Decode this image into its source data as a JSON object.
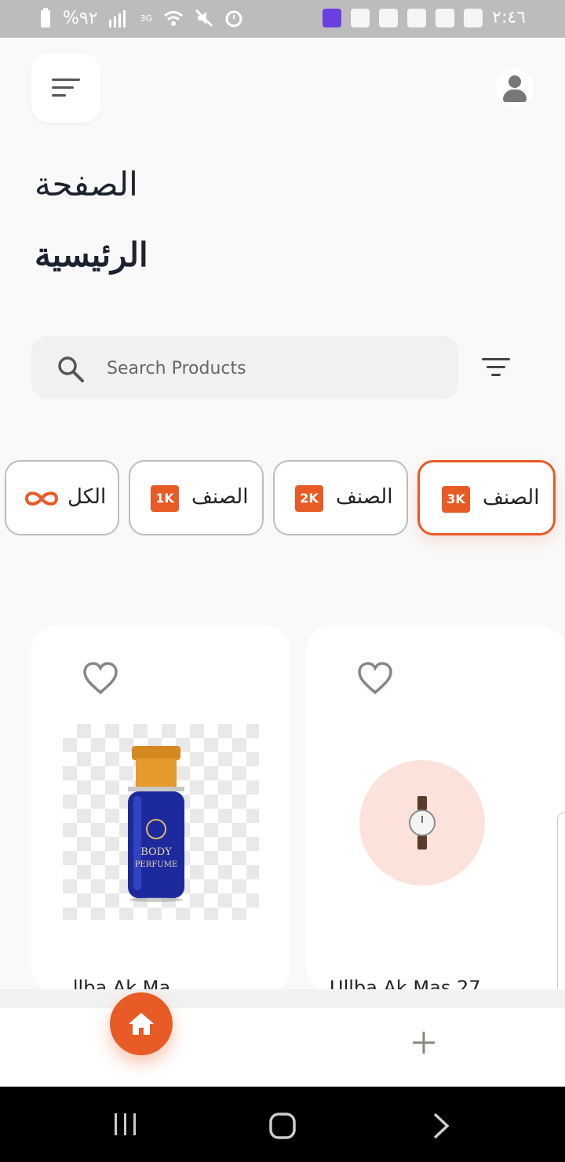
{
  "status_bar": {
    "battery": "%٩٢",
    "network": "3G",
    "time": "٢:٤٦"
  },
  "header": {
    "menu_icon": "sort-menu-icon",
    "profile_icon": "person-icon"
  },
  "page_title": {
    "line1": "الصفحة",
    "line2": "الرئيسية"
  },
  "search": {
    "placeholder": "Search Products",
    "icon": "search-icon",
    "filter_icon": "filter-icon"
  },
  "categories": [
    {
      "label": "الكل",
      "icon": "infinity-icon",
      "active": false
    },
    {
      "label": "الصنف",
      "badge": "1K",
      "active": false
    },
    {
      "label": "الصنف",
      "badge": "2K",
      "active": false
    },
    {
      "label": "الصنف",
      "badge": "3K",
      "active": true
    }
  ],
  "products": [
    {
      "name": "...llba Ak Ma",
      "image_text_1": "BODY",
      "image_text_2": "PERFUME",
      "favorite_icon": "heart-outline-icon"
    },
    {
      "name": "Ullba Ak Mas 27",
      "favorite_icon": "heart-outline-icon"
    }
  ],
  "bottom_nav": {
    "home_icon": "home-icon",
    "add_icon": "plus-icon"
  },
  "colors": {
    "accent": "#e85a26",
    "background": "#f9f9f9",
    "title": "#1c2230"
  }
}
